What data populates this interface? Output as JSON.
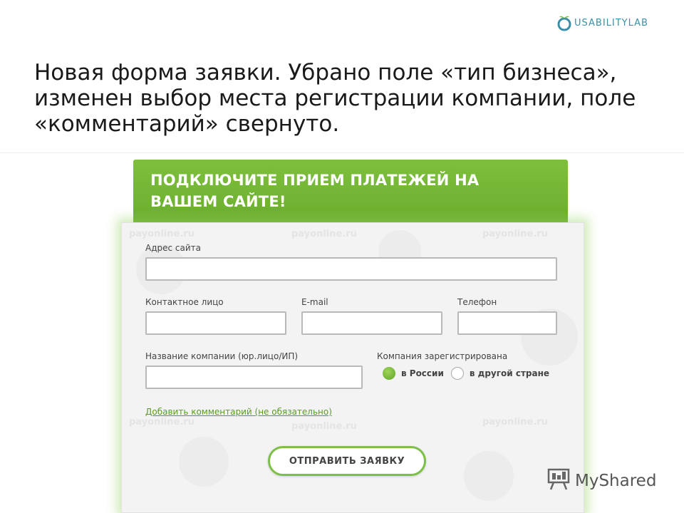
{
  "logo": {
    "text": "USABILITYLAB",
    "icon": "usabilitylab-logo-icon",
    "color": "#3c8fa8"
  },
  "slide": {
    "title": "Новая форма заявки. Убрано поле «тип бизнеса», изменен выбор места регистрации компании, поле «комментарий» свернуто."
  },
  "form": {
    "header": "ПОДКЛЮЧИТЕ ПРИЕМ ПЛАТЕЖЕЙ НА ВАШЕМ САЙТЕ!",
    "header_color": "#72b535",
    "watermark": "payonline.ru",
    "fields": {
      "site_address": {
        "label": "Адрес сайта",
        "value": ""
      },
      "contact_person": {
        "label": "Контактное лицо",
        "value": ""
      },
      "email": {
        "label": "E-mail",
        "value": ""
      },
      "phone": {
        "label": "Телефон",
        "value": ""
      },
      "company_name": {
        "label": "Название компании (юр.лицо/ИП)",
        "value": ""
      }
    },
    "registration": {
      "label": "Компания зарегистрирована",
      "options": [
        {
          "label": "в России",
          "selected": true
        },
        {
          "label": "в другой стране",
          "selected": false
        }
      ]
    },
    "add_comment_link": "Добавить комментарий (не обязательно)",
    "submit_label": "ОТПРАВИТЬ ЗАЯВКУ",
    "accent_color": "#7cc04a"
  },
  "footer": {
    "brand": "MyShared",
    "icon": "presentation-board-icon"
  }
}
